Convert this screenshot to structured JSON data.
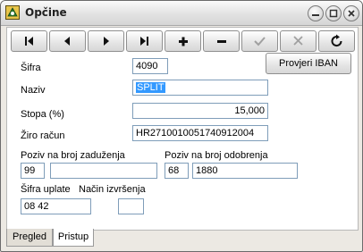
{
  "window": {
    "title": "Opčine"
  },
  "toolbar": {
    "buttons": [
      {
        "icon": "first-record-icon"
      },
      {
        "icon": "previous-record-icon"
      },
      {
        "icon": "next-record-icon"
      },
      {
        "icon": "last-record-icon"
      },
      {
        "icon": "add-icon"
      },
      {
        "icon": "delete-icon"
      },
      {
        "icon": "confirm-icon"
      },
      {
        "icon": "cancel-icon"
      },
      {
        "icon": "refresh-icon"
      }
    ],
    "iban_button": "Provjeri IBAN"
  },
  "form": {
    "sifra": {
      "label": "Šifra",
      "value": "4090"
    },
    "naziv": {
      "label": "Naziv",
      "value": "SPLIT"
    },
    "stopa": {
      "label": "Stopa (%)",
      "value": "15,000"
    },
    "ziro": {
      "label": "Žiro račun",
      "value": "HR2710010051740912004"
    },
    "poziv_zaduzenja": {
      "label": "Poziv na broj zaduženja",
      "model": "99",
      "number": ""
    },
    "poziv_odobrenja": {
      "label": "Poziv na broj odobrenja",
      "model": "68",
      "number": "1880"
    },
    "sifra_uplate": {
      "label": "Šifra uplate",
      "value": "08 42"
    },
    "nacin_izvrsenja": {
      "label": "Način izvršenja",
      "value": ""
    }
  },
  "tabs": [
    {
      "label": "Pregled",
      "active": false
    },
    {
      "label": "Pristup",
      "active": true
    }
  ]
}
